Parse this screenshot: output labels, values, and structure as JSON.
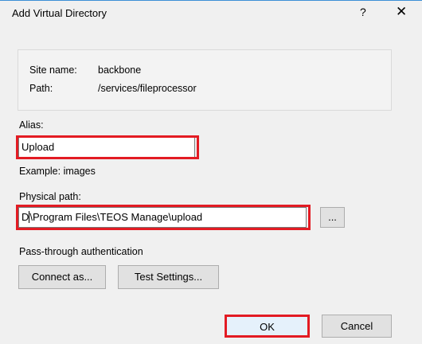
{
  "dialog": {
    "title": "Add Virtual Directory",
    "help_label": "?",
    "close_label": "✕"
  },
  "info": {
    "site_name_label": "Site name:",
    "site_name_value": "backbone",
    "path_label": "Path:",
    "path_value": "/services/fileprocessor"
  },
  "alias": {
    "label": "Alias:",
    "value": "Upload",
    "example": "Example: images"
  },
  "physical_path": {
    "label": "Physical path:",
    "value_prefix": "D",
    "value_rest": "\\Program Files\\TEOS Manage\\upload",
    "browse_label": "..."
  },
  "auth": {
    "label": "Pass-through authentication",
    "connect_as_label": "Connect as...",
    "test_settings_label": "Test Settings..."
  },
  "buttons": {
    "ok_label": "OK",
    "cancel_label": "Cancel"
  },
  "colors": {
    "highlight": "#e31b23",
    "background": "#f0f0f0",
    "title_accent": "#3c8fd6"
  }
}
